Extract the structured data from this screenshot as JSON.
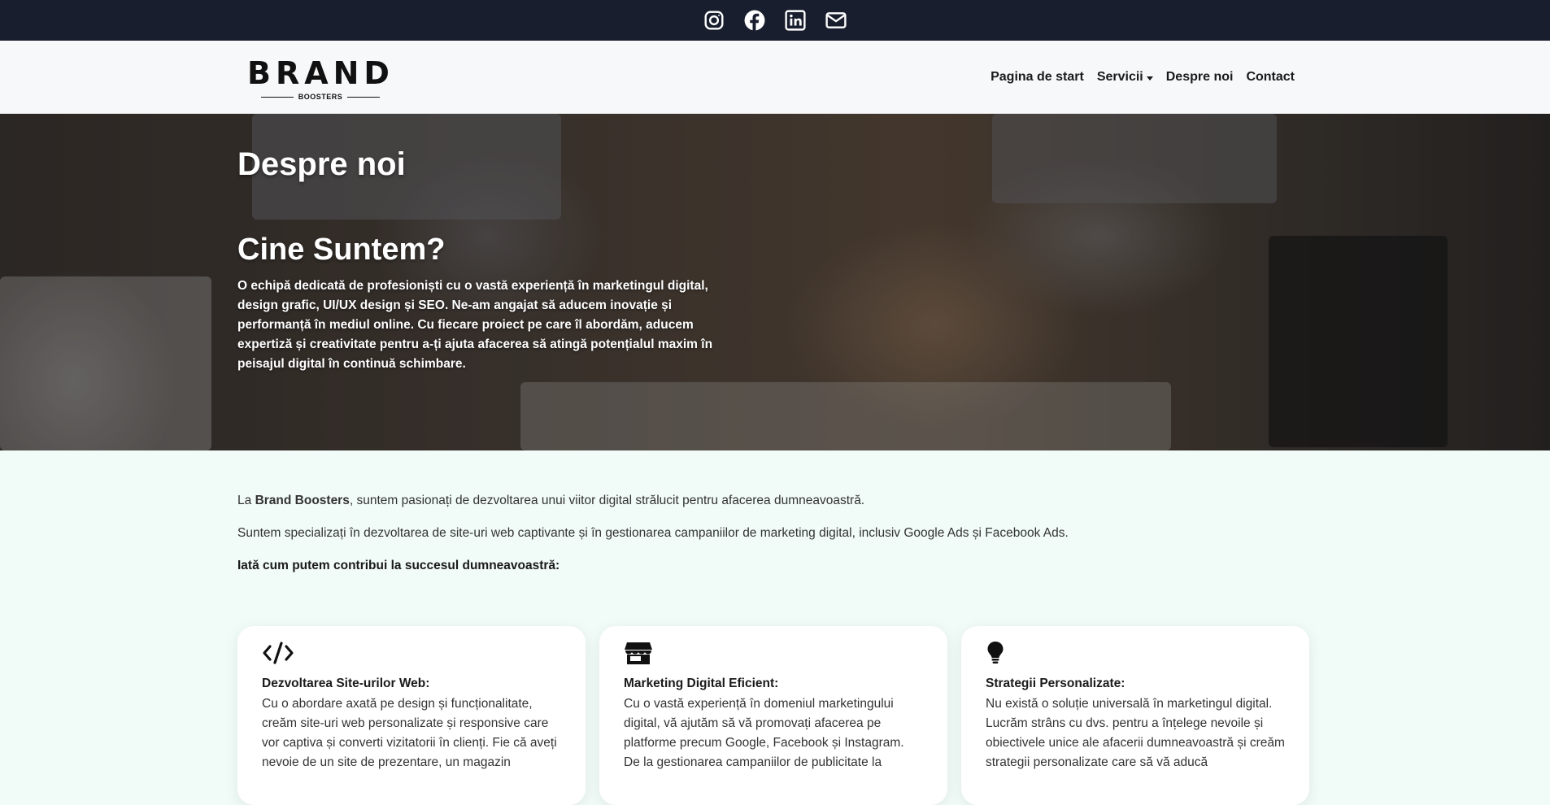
{
  "social": [
    {
      "name": "instagram-icon"
    },
    {
      "name": "facebook-icon"
    },
    {
      "name": "linkedin-icon"
    },
    {
      "name": "envelope-icon"
    }
  ],
  "logo": {
    "main": "BRAND",
    "sub": "BOOSTERS"
  },
  "nav": {
    "home": "Pagina de start",
    "services": "Servicii",
    "about": "Despre noi",
    "contact": "Contact"
  },
  "hero": {
    "page_title": "Despre noi",
    "heading": "Cine Suntem?",
    "text": "O echipă dedicată de profesioniști cu o vastă experiență în marketingul digital, design grafic, UI/UX design și SEO. Ne-am angajat să aducem inovație și performanță în mediul online. Cu fiecare proiect pe care îl abordăm, aducem expertiză și creativitate pentru a-ți ajuta afacerea să atingă potențialul maxim în peisajul digital în continuă schimbare."
  },
  "intro": {
    "p1_prefix": "La ",
    "p1_brand": "Brand Boosters",
    "p1_suffix": ", suntem pasionați de dezvoltarea unui viitor digital strălucit pentru afacerea dumneavoastră.",
    "p2": "Suntem specializați în dezvoltarea de site-uri web captivante și în gestionarea campaniilor de marketing digital, inclusiv Google Ads și Facebook Ads.",
    "p3": "Iată cum putem contribui la succesul dumneavoastră:"
  },
  "cards": [
    {
      "icon": "code-icon",
      "title": "Dezvoltarea Site-urilor Web:",
      "text": "Cu o abordare axată pe design și funcționalitate, creăm site-uri web personalizate și responsive care vor captiva și converti vizitatorii în clienți. Fie că aveți nevoie de un site de prezentare, un magazin"
    },
    {
      "icon": "shop-icon",
      "title": "Marketing Digital Eficient:",
      "text": "Cu o vastă experiență în domeniul marketingului digital, vă ajutăm să vă promovați afacerea pe platforme precum Google, Facebook și Instagram. De la gestionarea campaniilor de publicitate la"
    },
    {
      "icon": "lightbulb-icon",
      "title": "Strategii Personalizate:",
      "text": "Nu există o soluție universală în marketingul digital. Lucrăm strâns cu dvs. pentru a înțelege nevoile și obiectivele unice ale afacerii dumneavoastră și creăm strategii personalizate care să vă aducă"
    }
  ],
  "colors": {
    "topbar": "#181e2d",
    "navbar": "#f7f8fa",
    "page_bg": "#f1fbf8"
  }
}
